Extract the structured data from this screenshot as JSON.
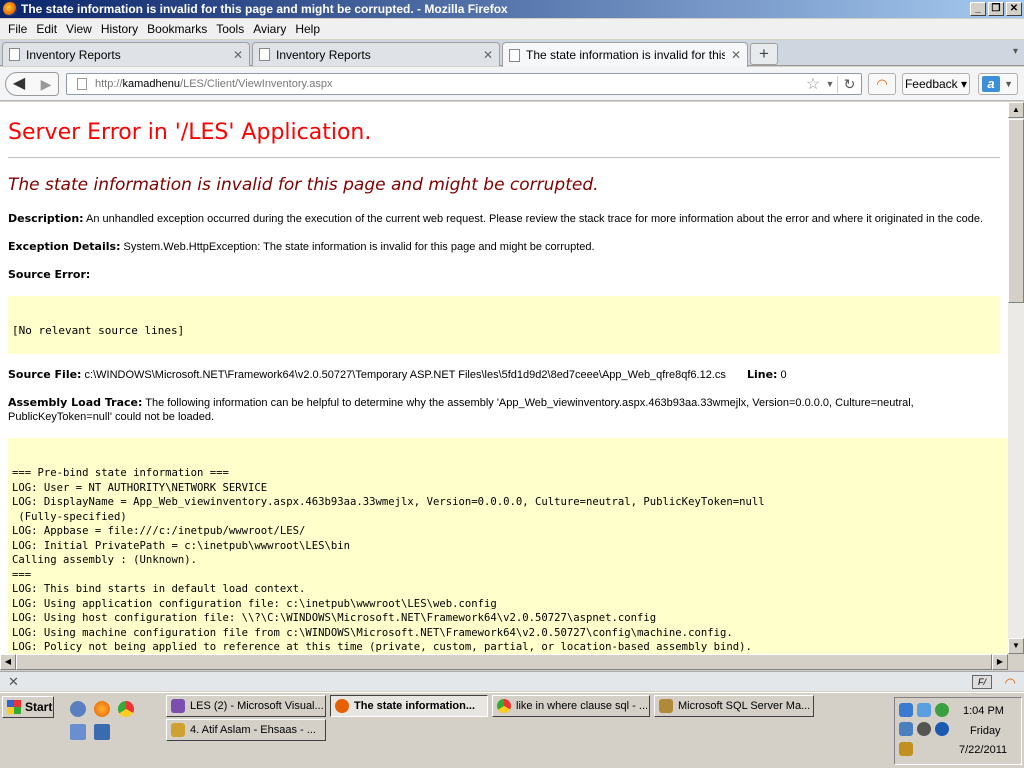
{
  "window": {
    "title": "The state information is invalid for this page and might be corrupted. - Mozilla Firefox",
    "buttons": {
      "minimize": "_",
      "maximize": "❐",
      "close": "✕"
    }
  },
  "menu": [
    "File",
    "Edit",
    "View",
    "History",
    "Bookmarks",
    "Tools",
    "Aviary",
    "Help"
  ],
  "tabs": [
    {
      "label": "Inventory Reports",
      "active": false
    },
    {
      "label": "Inventory Reports",
      "active": false
    },
    {
      "label": "The state information is invalid for this pa...",
      "active": true
    }
  ],
  "nav": {
    "url_prefix": "http://",
    "url_host": "kamadhenu",
    "url_path": "/LES/Client/ViewInventory.aspx",
    "feedback_label": "Feedback"
  },
  "page": {
    "server_error_title": "Server Error in '/LES' Application.",
    "error_heading": "The state information is invalid for this page and might be corrupted.",
    "description_label": "Description:",
    "description_text": "An unhandled exception occurred during the execution of the current web request. Please review the stack trace for more information about the error and where it originated in the code.",
    "exception_label": "Exception Details:",
    "exception_text": "System.Web.HttpException: The state information is invalid for this page and might be corrupted.",
    "source_error_label": "Source Error:",
    "source_error_text": "[No relevant source lines]",
    "source_file_label": "Source File:",
    "source_file_text": "c:\\WINDOWS\\Microsoft.NET\\Framework64\\v2.0.50727\\Temporary ASP.NET Files\\les\\5fd1d9d2\\8ed7ceee\\App_Web_qfre8qf6.12.cs",
    "line_label": "Line:",
    "line_value": "0",
    "assembly_label": "Assembly Load Trace:",
    "assembly_text": "The following information can be helpful to determine why the assembly 'App_Web_viewinventory.aspx.463b93aa.33wmejlx, Version=0.0.0.0, Culture=neutral, PublicKeyToken=null' could not be loaded.",
    "trace_lines": [
      "=== Pre-bind state information ===",
      "LOG: User = NT AUTHORITY\\NETWORK SERVICE",
      "LOG: DisplayName = App_Web_viewinventory.aspx.463b93aa.33wmejlx, Version=0.0.0.0, Culture=neutral, PublicKeyToken=null",
      " (Fully-specified)",
      "LOG: Appbase = file:///c:/inetpub/wwwroot/LES/",
      "LOG: Initial PrivatePath = c:\\inetpub\\wwwroot\\LES\\bin",
      "Calling assembly : (Unknown).",
      "===",
      "LOG: This bind starts in default load context.",
      "LOG: Using application configuration file: c:\\inetpub\\wwwroot\\LES\\web.config",
      "LOG: Using host configuration file: \\\\?\\C:\\WINDOWS\\Microsoft.NET\\Framework64\\v2.0.50727\\aspnet.config",
      "LOG: Using machine configuration file from c:\\WINDOWS\\Microsoft.NET\\Framework64\\v2.0.50727\\config\\machine.config.",
      "LOG: Policy not being applied to reference at this time (private, custom, partial, or location-based assembly bind)."
    ]
  },
  "taskbar": {
    "start_label": "Start",
    "buttons": [
      {
        "label": "LES (2) - Microsoft Visual...",
        "active": false,
        "color": "#7a4fb0"
      },
      {
        "label": "The state information...",
        "active": true,
        "color": "#e66000"
      },
      {
        "label": "like in where clause sql - ...",
        "active": false,
        "color": "#3a9a3a"
      },
      {
        "label": "Microsoft SQL Server Ma...",
        "active": false,
        "color": "#b08a3a"
      },
      {
        "label": "4. Atif Aslam - Ehsaas - ...",
        "active": false,
        "color": "#d0a030"
      }
    ],
    "clock": {
      "time": "1:04 PM",
      "day": "Friday",
      "date": "7/22/2011"
    }
  }
}
